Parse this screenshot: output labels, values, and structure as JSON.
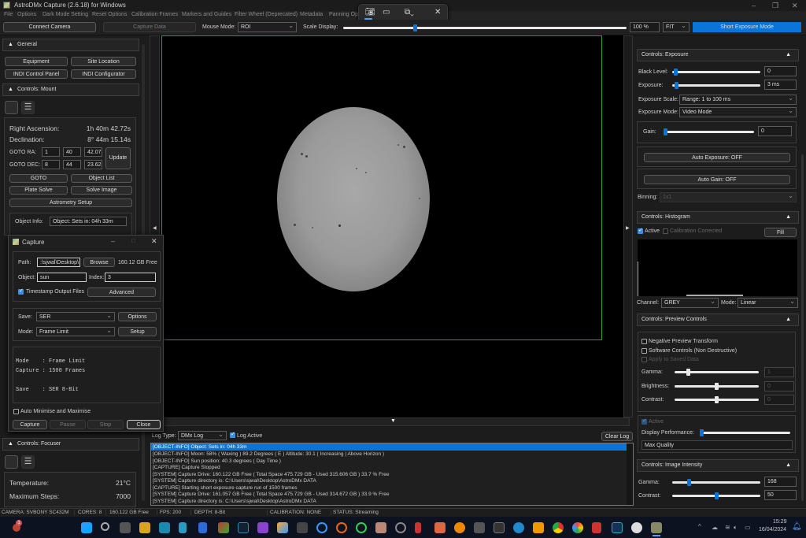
{
  "window": {
    "title": "AstroDMx Capture (2.6.18) for Windows"
  },
  "menu": [
    "File",
    "Options",
    "Dark Mode Setting",
    "Reset Options",
    "Calibration Frames",
    "Markers and Guides",
    "Filter Wheel (Deprecated)",
    "Metadata",
    "Panning Opt"
  ],
  "snip_tool": {
    "icons": [
      "camera-icon",
      "video-icon",
      "window-mode-icon",
      "close-icon"
    ]
  },
  "toolbar": {
    "connect_camera": "Connect Camera",
    "capture_data": "Capture Data",
    "mouse_mode_label": "Mouse Mode:",
    "mouse_mode_value": "ROI",
    "scale_display_label": "Scale Display:",
    "scale_display_fraction": 0.25,
    "zoom_value": "100 %",
    "fit_value": "FIT",
    "short_exposure_mode": "Short Exposure Mode"
  },
  "left": {
    "general": {
      "title": "General",
      "buttons": [
        "Equipment",
        "Site Location",
        "INDI Control Panel",
        "INDI Configurator"
      ]
    },
    "mount": {
      "title": "Controls: Mount",
      "ra_label": "Right Ascension:",
      "ra_value": "1h 40m 42.72s",
      "dec_label": "Declination:",
      "dec_value": "8° 44m 15.14s",
      "goto_ra_label": "GOTO RA:",
      "goto_ra": [
        "1",
        "40",
        "42.07"
      ],
      "goto_dec_label": "GOTO DEC:",
      "goto_dec": [
        "8",
        "44",
        "23.62"
      ],
      "update": "Update",
      "buttons": [
        "GOTO",
        "Object List",
        "Plate Solve",
        "Solve Image",
        "Astrometry Setup"
      ],
      "object_info_label": "Object Info:",
      "object_info_value": "Object: Sets in: 04h 33m"
    },
    "focuser": {
      "title": "Controls: Focuser",
      "temperature_label": "Temperature:",
      "temperature_value": "21°C",
      "max_steps_label": "Maximum Steps:",
      "max_steps_value": "7000"
    }
  },
  "capture_dialog": {
    "title": "Capture",
    "path_label": "Path:",
    "path_value": ":\\sjwal\\Desktop\\",
    "browse": "Browse",
    "free": "160.12 GB Free",
    "object_label": "Object:",
    "object_value": "sun",
    "index_label": "Index:",
    "index_value": "3",
    "timestamp_label": "Timestamp Output Files",
    "timestamp_checked": true,
    "advanced": "Advanced",
    "save_label": "Save:",
    "save_value": "SER",
    "options": "Options",
    "mode_label": "Mode:",
    "mode_value": "Frame Limit",
    "setup": "Setup",
    "summary": [
      "Mode    : Frame Limit",
      "Capture : 1500 Frames",
      "",
      "Save    : SER 8-Bit"
    ],
    "auto_minimise_label": "Auto Minimise and Maximise",
    "buttons": {
      "capture": "Capture",
      "pause": "Pause",
      "stop": "Stop",
      "close": "Close"
    }
  },
  "right": {
    "exposure": {
      "title": "Controls: Exposure",
      "black_level_label": "Black Level:",
      "black_level_value": "0",
      "black_level_fraction": 0.02,
      "exposure_label": "Exposure:",
      "exposure_value": "3 ms",
      "exposure_fraction": 0.03,
      "scale_label": "Exposure Scale:",
      "scale_value": "Range: 1 to 100 ms",
      "mode_label": "Exposure Mode:",
      "mode_value": "Video Mode",
      "gain_label": "Gain:",
      "gain_value": "0",
      "gain_fraction": 0.0,
      "auto_exposure": "Auto Exposure: OFF",
      "auto_gain": "Auto Gain: OFF",
      "binning_label": "Binning:",
      "binning_value": "1x1"
    },
    "histogram": {
      "title": "Controls: Histogram",
      "active_label": "Active",
      "calibration_label": "Calibration Corrected",
      "fill": "Fill",
      "channel_label": "Channel:",
      "channel_value": "GREY",
      "mode_label": "Mode:",
      "mode_value": "Linear"
    },
    "preview": {
      "title": "Controls: Preview Controls",
      "negative": "Negative Preview Transform",
      "software": "Software Controls (Non Destructive)",
      "apply": "Apply to Saved Data",
      "gamma_label": "Gamma:",
      "gamma_value": "1",
      "gamma_fraction": 0.15,
      "brightness_label": "Brightness:",
      "brightness_value": "0",
      "brightness_fraction": 0.5,
      "contrast_label": "Contrast:",
      "contrast_value": "0",
      "contrast_fraction": 0.5,
      "active_label": "Active",
      "display_perf_label": "Display Performance:",
      "display_perf_fraction": 0.0,
      "display_perf_value": "Max Quality"
    },
    "intensity": {
      "title": "Controls: Image Intensity",
      "gamma_label": "Gamma:",
      "gamma_value": "168",
      "gamma_fraction": 0.18,
      "contrast_label": "Contrast:",
      "contrast_value": "50",
      "contrast_fraction": 0.5
    }
  },
  "log": {
    "type_label": "Log Type:",
    "type_value": "DMx Log",
    "active_label": "Log Active",
    "clear": "Clear Log",
    "lines": [
      "[OBJECT-INFO] Object: Sets in: 04h 33m",
      "[OBJECT-INFO] Moon: 58% ( Waxing ) 89.2 Degrees ( E ) Altitude: 30.1 ( Increasing | Above Horizon )",
      "[OBJECT-INFO] Sun position: 40.3 degrees ( Day Time )",
      "[CAPTURE] Capture Stopped",
      "[SYSTEM]  Capture Drive: 160.122 GB Free ( Total Space 475.729 GB - Used 315.606 GB ) 33.7 % Free",
      "[SYSTEM]  Capture directory is: C:\\Users\\sjwal\\Desktop\\AstroDMx DATA",
      "[CAPTURE] Starting short exposure capture run of 1500 frames",
      "[SYSTEM]  Capture Drive: 161.057 GB Free ( Total Space 475.729 GB - Used 314.672 GB ) 33.9 % Free",
      "[SYSTEM]  Capture directory is: C:\\Users\\sjwal\\Desktop\\AstroDMx DATA"
    ]
  },
  "status": {
    "camera": "CAMERA: SVBONY SC432M",
    "cores": "CORES: 8",
    "free": "160.122 GB Free",
    "fps": "FPS: 200",
    "depth": "DEPTH: 8-Bit",
    "calibration": "CALIBRATION: NONE",
    "status": "STATUS: Streaming"
  },
  "taskbar": {
    "time": "15:29",
    "date": "16/04/2024",
    "badge": "1"
  },
  "colors": {
    "accent": "#0a74d8",
    "roi": "#2ca02c"
  }
}
